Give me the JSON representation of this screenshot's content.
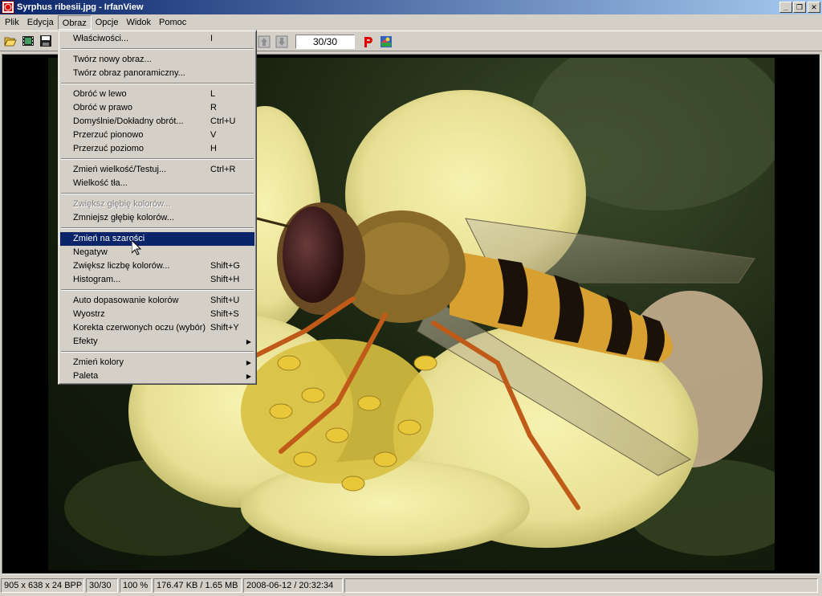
{
  "window": {
    "title": "Syrphus ribesii.jpg - IrfanView"
  },
  "menubar": {
    "items": [
      "Plik",
      "Edycja",
      "Obraz",
      "Opcje",
      "Widok",
      "Pomoc"
    ]
  },
  "toolbar": {
    "position_value": "30/30"
  },
  "image_menu": {
    "items": [
      {
        "label": "Właściwości...",
        "shortcut": "I"
      },
      {
        "label": "Twórz nowy obraz...",
        "shortcut": ""
      },
      {
        "label": "Twórz obraz panoramiczny...",
        "shortcut": ""
      },
      {
        "label": "Obróć w lewo",
        "shortcut": "L"
      },
      {
        "label": "Obróć w prawo",
        "shortcut": "R"
      },
      {
        "label": "Domyślnie/Dokładny obrót...",
        "shortcut": "Ctrl+U"
      },
      {
        "label": "Przerzuć pionowo",
        "shortcut": "V"
      },
      {
        "label": "Przerzuć poziomo",
        "shortcut": "H"
      },
      {
        "label": "Zmień wielkość/Testuj...",
        "shortcut": "Ctrl+R"
      },
      {
        "label": "Wielkość tła...",
        "shortcut": ""
      },
      {
        "label": "Zwiększ głębię kolorów...",
        "shortcut": ""
      },
      {
        "label": "Zmniejsz głębię kolorów...",
        "shortcut": ""
      },
      {
        "label": "Zmień na szarości",
        "shortcut": ""
      },
      {
        "label": "Negatyw",
        "shortcut": ""
      },
      {
        "label": "Zwiększ liczbę kolorów...",
        "shortcut": "Shift+G"
      },
      {
        "label": "Histogram...",
        "shortcut": "Shift+H"
      },
      {
        "label": "Auto dopasowanie kolorów",
        "shortcut": "Shift+U"
      },
      {
        "label": "Wyostrz",
        "shortcut": "Shift+S"
      },
      {
        "label": "Korekta czerwonych oczu (wybór)",
        "shortcut": "Shift+Y"
      },
      {
        "label": "Efekty",
        "shortcut": ""
      },
      {
        "label": "Zmień kolory",
        "shortcut": ""
      },
      {
        "label": "Paleta",
        "shortcut": ""
      }
    ]
  },
  "statusbar": {
    "dimensions": "905 x 638 x 24 BPP",
    "position": "30/30",
    "zoom": "100 %",
    "filesize": "176.47 KB / 1.65 MB",
    "datetime": "2008-06-12 / 20:32:34"
  },
  "colors": {
    "highlight": "#0a246a",
    "face": "#d4d0c8"
  }
}
